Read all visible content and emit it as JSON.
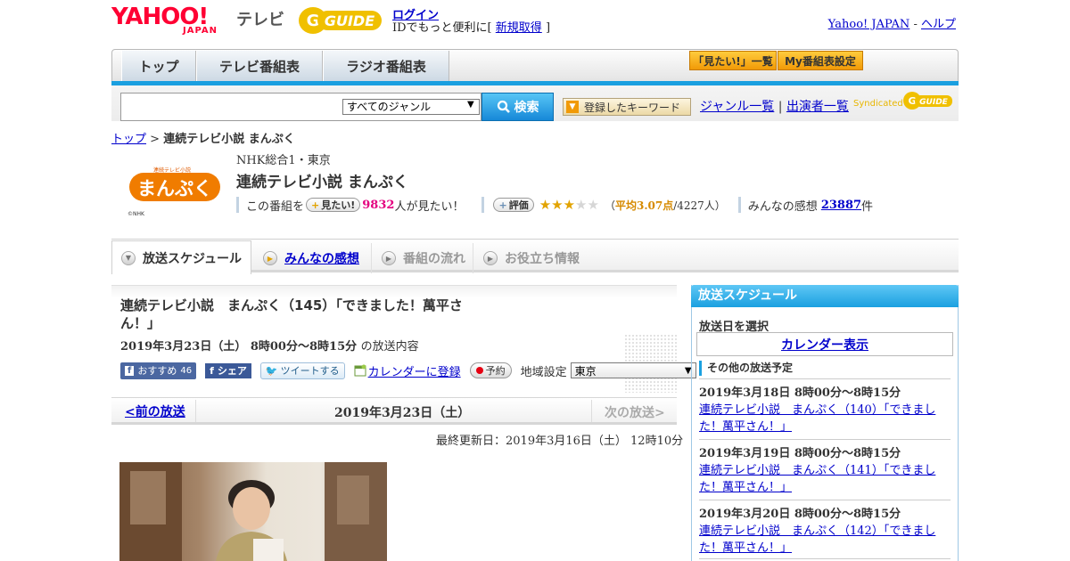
{
  "header": {
    "logo_yahoo": "YAHOO!",
    "logo_japan": "JAPAN",
    "logo_tv": "テレビ",
    "logo_gguide": "GUIDE",
    "login": "ログイン",
    "promo_prefix": "IDでもっと便利に[",
    "register": "新規取得",
    "promo_suffix": "]",
    "yahoo_japan": "Yahoo! JAPAN",
    "separator": "-",
    "help": "ヘルプ"
  },
  "nav": {
    "tabs": [
      "トップ",
      "テレビ番組表",
      "ラジオ番組表"
    ],
    "want_list": "「見たい!」一覧",
    "my_schedule": "My番組表設定"
  },
  "search": {
    "placeholder": "",
    "genre": "すべてのジャンル",
    "button": "検索",
    "keyword_button": "登録したキーワード",
    "genre_list": "ジャンル一覧",
    "divider": "|",
    "cast_list": "出演者一覧",
    "syndicated": "Syndicated"
  },
  "breadcrumb": {
    "top": "トップ",
    "sep": ">",
    "current": "連続テレビ小説 まんぷく"
  },
  "program": {
    "logo_text": "まんぷく",
    "logo_small": "連続テレビ小説",
    "logo_credit": "©NHK",
    "channel": "NHK総合1・東京",
    "title": "連続テレビ小説 まんぷく",
    "want_prefix": "この番組を",
    "want_button": "見たい!",
    "want_count": "9832",
    "want_suffix": "人が見たい！",
    "rate_button": "評価",
    "rating": 3,
    "rating_max": 5,
    "avg_open": "（",
    "avg_label": "平均3.07点",
    "avg_count": "/4227人）",
    "impressions_label": "みんなの感想",
    "impressions_count": "23887",
    "impressions_suffix": "件"
  },
  "subtabs": [
    {
      "label": "放送スケジュール",
      "active": true
    },
    {
      "label": "みんなの感想",
      "link": true
    },
    {
      "label": "番組の流れ"
    },
    {
      "label": "お役立ち情報"
    }
  ],
  "episode": {
    "title": "連続テレビ小説　まんぷく（145）「できました！萬平さん！」",
    "date": "2019年3月23日（土）  8時00分～8時15分",
    "date_tail": "の放送内容",
    "fb_recommend": "おすすめ",
    "fb_count": "46",
    "fb_share": "シェア",
    "tweet": "ツイートする",
    "calendar_register": "カレンダーに登録",
    "reserve": "予約",
    "region_label": "地域設定",
    "region_value": "東京"
  },
  "pager": {
    "prev": "<前の放送",
    "current": "2019年3月23日（土）",
    "next": "次の放送>"
  },
  "updated": "最終更新日：2019年3月16日（土）  12時10分",
  "sidebar": {
    "title": "放送スケジュール",
    "select_label": "放送日を選択",
    "calendar": "カレンダー表示",
    "other_label": "その他の放送予定",
    "items": [
      {
        "date": "2019年3月18日  8時00分～8時15分",
        "title": "連続テレビ小説　まんぷく（140）「できました！萬平さん！」"
      },
      {
        "date": "2019年3月19日  8時00分～8時15分",
        "title": "連続テレビ小説　まんぷく（141）「できました！萬平さん！」"
      },
      {
        "date": "2019年3月20日  8時00分～8時15分",
        "title": "連続テレビ小説　まんぷく（142）「できました！萬平さん！」"
      }
    ]
  },
  "colors": {
    "yahoo_red": "#ff0033",
    "accent_blue": "#1a9fe0",
    "orange": "#f19a07",
    "pink": "#e4007f"
  }
}
